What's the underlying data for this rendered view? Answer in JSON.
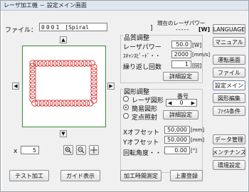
{
  "window": {
    "title": "レーザ加工機 － 設定メイン画面"
  },
  "header": {
    "file_label": "ファイル：",
    "file_number": "0001",
    "file_name": "[Spiral",
    "file_name_end": "]",
    "power_now_label": "現在のレーザパワー",
    "power_now_value": "-----",
    "power_now_unit": "[W]"
  },
  "quality": {
    "title": "品質調整",
    "laser_power_label": "レーザパワー",
    "laser_power_value": "50.0",
    "laser_power_unit": "[W]",
    "scan_speed_label": "ｽｷｬﾝｽﾋﾟｰﾄﾞ・・",
    "scan_speed_value": "2000",
    "scan_speed_unit": "[mm/s]",
    "repeat_label": "繰り返し回数",
    "repeat_value": "1",
    "repeat_unit": "[回]",
    "detail_button": "詳細設定"
  },
  "shape": {
    "title": "図形調整",
    "radio_laser": "レーザ図形",
    "radio_simple": "簡易図形",
    "radio_point": "定点照射",
    "number_label": "番号",
    "number_value": "0",
    "detail_button": "詳細設定",
    "x_offset_label": "Xオフセット",
    "x_offset_value": "50.000",
    "x_offset_unit": "[mm]",
    "y_offset_label": "Yオフセット",
    "y_offset_value": "50.000",
    "y_offset_unit": "[mm]",
    "rotation_label": "回転角度・・・",
    "rotation_value": "0.00",
    "rotation_unit": "[°]"
  },
  "preview": {
    "scale_label": "x",
    "scale_value": "5"
  },
  "bottom": {
    "test_button": "テスト加工",
    "guide_button": "ガイド表示",
    "time_button": "加工時間測定",
    "save_button": "上書登録"
  },
  "sidebar": {
    "language": "LANGUAGE",
    "manual": "マニュアル",
    "operation": "運転画面",
    "file": "ファイル",
    "settings_main": "設定メイン",
    "shape_edit": "図形編集",
    "file_condition": "ﾌｧｲﾙ条件",
    "data_manage": "データ管理",
    "maintenance": "メンテナンス",
    "env_settings": "環境設定"
  },
  "colors": {
    "spiral": "#d21e1e",
    "preview_border": "#3b8a3b"
  }
}
